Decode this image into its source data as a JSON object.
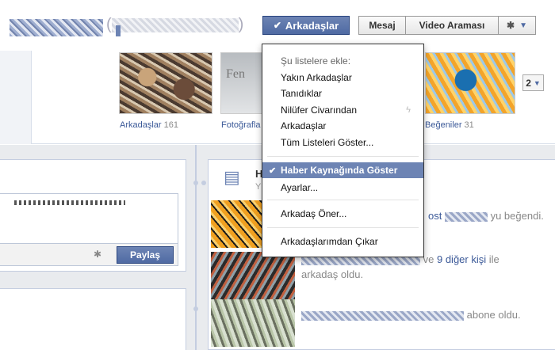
{
  "header": {
    "friends_button": "Arkadaşlar",
    "message_button": "Mesaj",
    "video_button": "Video Araması"
  },
  "strip": {
    "friends_label": "Arkadaşlar",
    "friends_count": "161",
    "photos_label": "Fotoğrafla",
    "likes_label": "Beğeniler",
    "likes_count": "31",
    "pager_label": "2",
    "photos_thumb_text": "Fen"
  },
  "composer": {
    "share_button": "Paylaş"
  },
  "news": {
    "heading": "H",
    "sub": "Y"
  },
  "feed": {
    "line1_suffix": "yu beğendi.",
    "line1_prefix": "ost",
    "line2_connector": "ve",
    "line2_link": "9 diğer kişi",
    "line2_suffix": "ile",
    "line2_second": "arkadaş oldu.",
    "line3_suffix": "abone oldu."
  },
  "menu": {
    "heading": "Şu listelere ekle:",
    "items": [
      "Yakın Arkadaşlar",
      "Tanıdıklar",
      "Nilüfer Civarından",
      "Arkadaşlar",
      "Tüm Listeleri Göster..."
    ],
    "news_feed": "Haber Kaynağında Göster",
    "settings": "Ayarlar...",
    "suggest": "Arkadaş Öner...",
    "remove": "Arkadaşlarımdan Çıkar"
  },
  "icons": {
    "check": "check-icon",
    "gear": "gear-icon",
    "caret": "caret-down-icon",
    "bolt": "lightning-icon",
    "news": "newsfeed-icon"
  },
  "colors": {
    "fb_blue": "#3b5998",
    "button_blue": "#4f6aa3",
    "menu_highlight": "#6d84b4"
  }
}
